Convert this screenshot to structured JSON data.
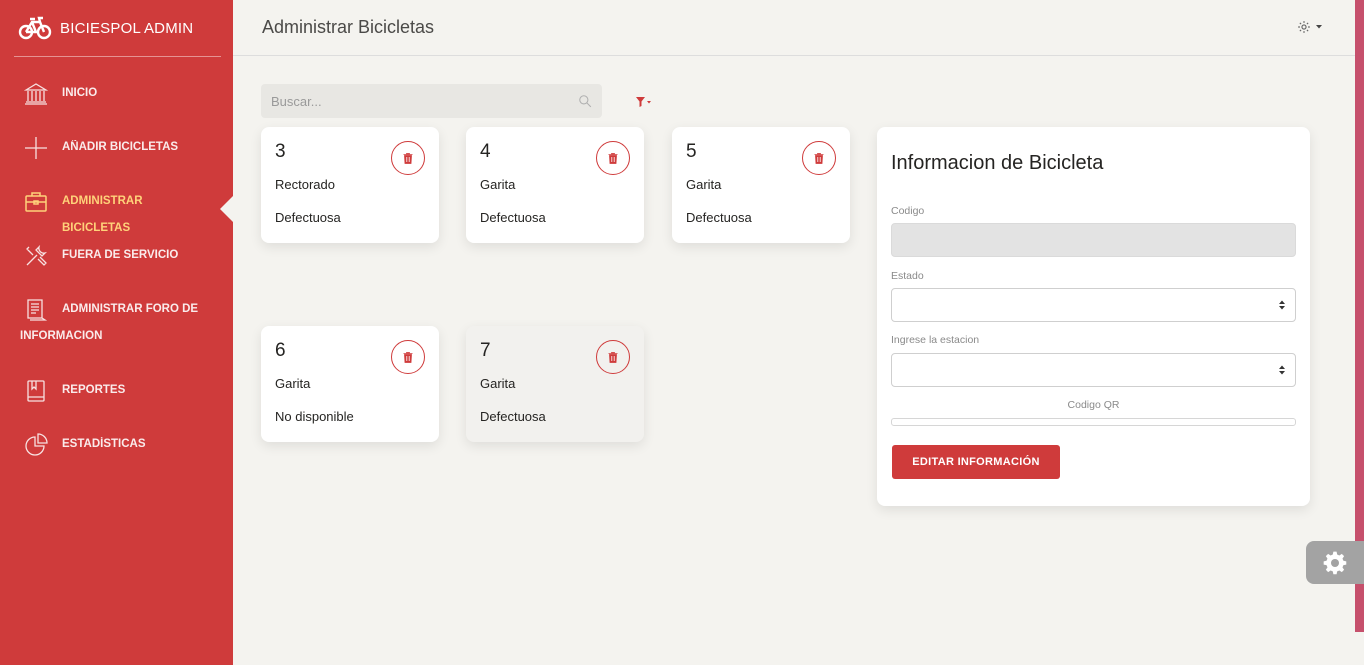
{
  "brand": {
    "name": "BICIESPOL ADMIN",
    "icon": "bicycle-icon"
  },
  "sidebar": {
    "items": [
      {
        "label": "INICIO",
        "icon": "bank-icon",
        "active": false
      },
      {
        "label": "AÑADIR BICICLETAS",
        "icon": "plus-icon",
        "active": false
      },
      {
        "label": "ADMINISTRAR BICICLETAS",
        "icon": "briefcase-icon",
        "active": true
      },
      {
        "label": "FUERA DE SERVICIO",
        "icon": "tools-icon",
        "active": false
      },
      {
        "label": "ADMINISTRAR FORO DE INFORMACION",
        "icon": "document-icon",
        "active": false
      },
      {
        "label": "REPORTES",
        "icon": "book-icon",
        "active": false
      },
      {
        "label": "ESTADÍSTICAS",
        "icon": "pie-chart-icon",
        "active": false
      }
    ],
    "active_color": "#ffd27a"
  },
  "header": {
    "title": "Administrar Bicicletas",
    "settings_icon": "gear-icon"
  },
  "search": {
    "placeholder": "Buscar...",
    "value": ""
  },
  "bikes": [
    {
      "number": "3",
      "location": "Rectorado",
      "status": "Defectuosa"
    },
    {
      "number": "4",
      "location": "Garita",
      "status": "Defectuosa"
    },
    {
      "number": "5",
      "location": "Garita",
      "status": "Defectuosa"
    },
    {
      "number": "6",
      "location": "Garita",
      "status": "No disponible"
    },
    {
      "number": "7",
      "location": "Garita",
      "status": "Defectuosa"
    }
  ],
  "info_panel": {
    "title": "Informacion de Bicicleta",
    "codigo_label": "Codigo",
    "codigo_value": "",
    "estado_label": "Estado",
    "estado_value": "",
    "estacion_label": "Ingrese la estacion",
    "estacion_value": "",
    "qr_label": "Codigo QR",
    "edit_button": "EDITAR INFORMACIÓN"
  },
  "colors": {
    "primary": "#cf3b3b",
    "background": "#f4f3ef",
    "accent_strip": "#c6506c"
  }
}
